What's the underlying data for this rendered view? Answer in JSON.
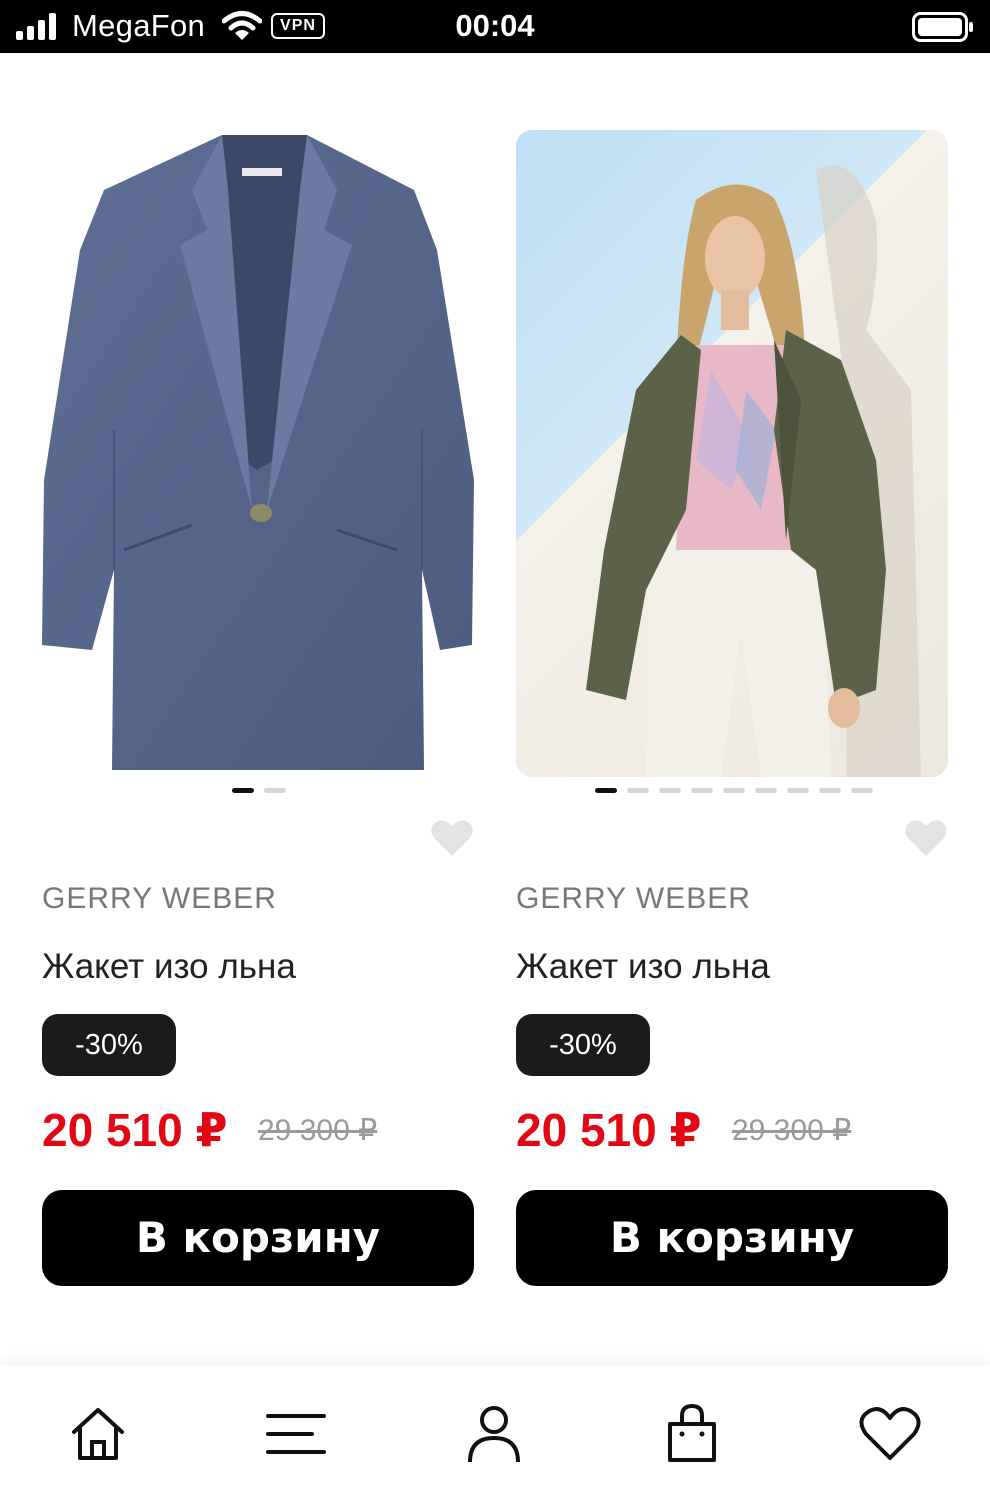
{
  "status_bar": {
    "carrier": "MegaFon",
    "vpn": "VPN",
    "time": "00:04"
  },
  "products": [
    {
      "brand": "GERRY WEBER",
      "title": "Жакет изо льна",
      "discount": "-30%",
      "price": "20 510 ₽",
      "old_price": "29 300 ₽",
      "cart_label": "В корзину",
      "image_count": 2,
      "active_image": 1
    },
    {
      "brand": "GERRY WEBER",
      "title": "Жакет изо льна",
      "discount": "-30%",
      "price": "20 510 ₽",
      "old_price": "29 300 ₽",
      "cart_label": "В корзину",
      "image_count": 9,
      "active_image": 1
    }
  ],
  "bottom_nav": {
    "items": [
      "home-icon",
      "menu-icon",
      "profile-icon",
      "bag-icon",
      "heart-icon"
    ]
  },
  "colors": {
    "sale_price": "#e30613",
    "button": "#000000",
    "badge": "#1b1b1b",
    "jacket_blue": "#56658c",
    "jacket_olive": "#5c6247"
  }
}
